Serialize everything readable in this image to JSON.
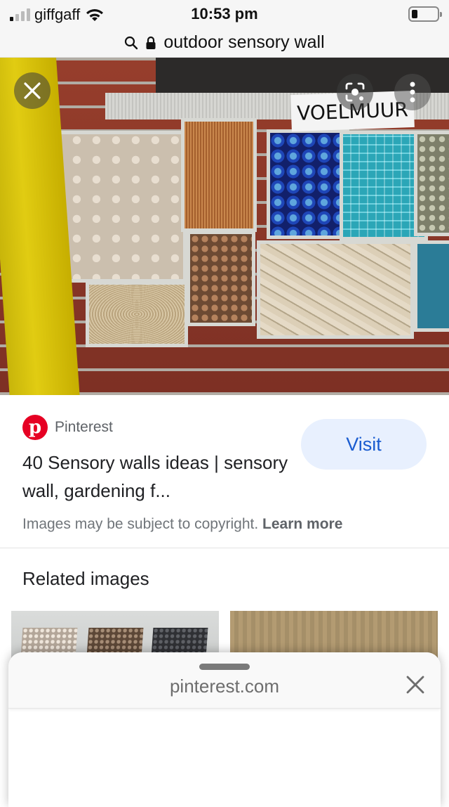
{
  "status_bar": {
    "carrier": "giffgaff",
    "time": "10:53 pm",
    "signal_bars_active": 1,
    "signal_bars_total": 4,
    "battery_level": 0.15,
    "icons": [
      "signal-icon",
      "wifi-icon",
      "battery-icon"
    ]
  },
  "url_bar": {
    "query": "outdoor sensory wall",
    "icons": [
      "search-icon",
      "lock-icon"
    ]
  },
  "hero_image": {
    "sign_text": "VOELMUUR",
    "buttons": {
      "close": "close-icon",
      "lens": "lens-search-icon",
      "more": "more-vert-icon"
    }
  },
  "result": {
    "source_name": "Pinterest",
    "source_icon": "pinterest-logo",
    "source_logo_letter": "p",
    "title": "40 Sensory walls ideas | sensory wall, gardening f...",
    "visit_label": "Visit",
    "copyright_text": "Images may be subject to copyright.",
    "learn_more_label": "Learn more"
  },
  "related": {
    "title": "Related images"
  },
  "sheet": {
    "domain": "pinterest.com",
    "close_icon": "close-icon"
  },
  "colors": {
    "pinterest_red": "#e60023",
    "visit_bg": "#e8f0fe",
    "visit_text": "#1a5cd0"
  }
}
